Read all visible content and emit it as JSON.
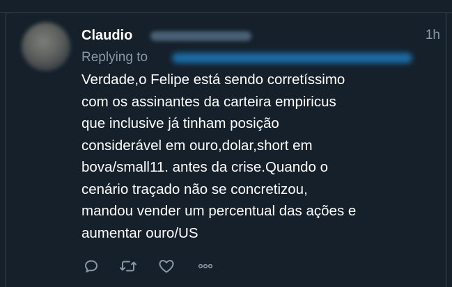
{
  "tweet": {
    "author_name": "Claudio",
    "timestamp": "1h",
    "replying_label": "Replying to",
    "text_lines": [
      "Verdade,o Felipe está sendo corretíssimo",
      "com os assinantes da carteira empiricus",
      "que inclusive já tinham posição",
      "considerável em ouro,dolar,short em",
      "bova/small11. antes da crise.Quando o",
      "cenário traçado não se concretizou,",
      "mandou vender um percentual das ações e",
      "aumentar ouro/US"
    ]
  },
  "actions": {
    "reply_icon": "reply-icon",
    "retweet_icon": "retweet-icon",
    "like_icon": "like-icon",
    "more_icon": "more-icon"
  },
  "colors": {
    "background": "#15202b",
    "text": "#ffffff",
    "secondary_text": "#8899a6",
    "border": "#38444d",
    "mention": "#1d9bf0"
  }
}
